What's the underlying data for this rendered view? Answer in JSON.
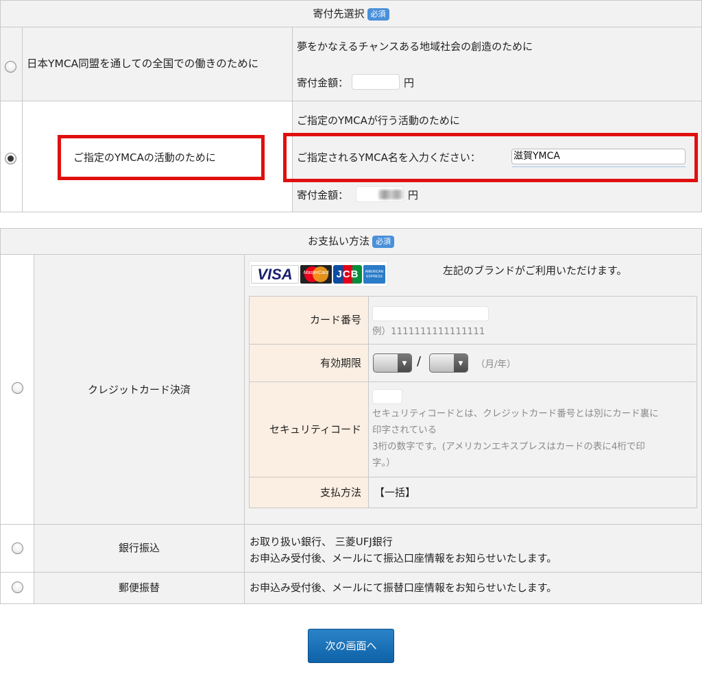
{
  "donation": {
    "header": "寄付先選択",
    "required_badge": "必須",
    "options": [
      {
        "label": "日本YMCA同盟を通しての全国での働きのために",
        "description": "夢をかなえるチャンスある地域社会の創造のために",
        "amount_label": "寄付金額：",
        "amount_unit": "円",
        "selected": false
      },
      {
        "label": "ご指定のYMCAの活動のために",
        "description": "ご指定のYMCAが行う活動のために",
        "name_prompt": "ご指定されるYMCA名を入力ください：",
        "name_value": "滋賀YMCA",
        "amount_label": "寄付金額：",
        "amount_unit": "円",
        "selected": true
      }
    ]
  },
  "payment": {
    "header": "お支払い方法",
    "required_badge": "必須",
    "credit": {
      "label": "クレジットカード決済",
      "brands": [
        "VISA",
        "MasterCard",
        "JCB",
        "AMERICAN EXPRESS"
      ],
      "brands_note": "左記のブランドがご利用いただけます。",
      "card_number_label": "カード番号",
      "card_number_example": "例）1111111111111111",
      "expiry_label": "有効期限",
      "expiry_separator": "/",
      "expiry_hint": "（月/年）",
      "cvc_label": "セキュリティコード",
      "cvc_help_1": "セキュリティコードとは、クレジットカード番号とは別にカード裏に",
      "cvc_help_2": "印字されている",
      "cvc_help_3": "3桁の数字です。(アメリカンエキスプレスはカードの表に4桁で印",
      "cvc_help_4": "字。）",
      "method_label": "支払方法",
      "method_value": "【一括】"
    },
    "bank": {
      "label": "銀行振込",
      "line1": "お取り扱い銀行、 三菱UFJ銀行",
      "line2": "お申込み受付後、メールにて振込口座情報をお知らせいたします。"
    },
    "postal": {
      "label": "郵便振替",
      "line1": "お申込み受付後、メールにて振替口座情報をお知らせいたします。"
    }
  },
  "next_button": "次の画面へ",
  "colors": {
    "highlight": "#e01010",
    "badge": "#4a90d9",
    "button": "#1a72b8",
    "label_bg": "#fbeee2"
  }
}
